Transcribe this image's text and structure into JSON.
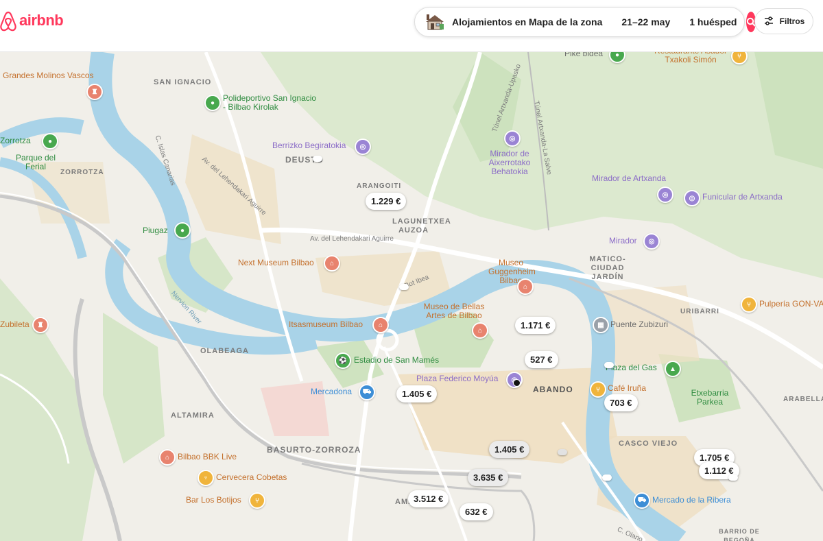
{
  "header": {
    "logo_text": "airbnb",
    "search": {
      "location": "Alojamientos en Mapa de la zona",
      "dates": "21–22 may",
      "guests": "1 huésped"
    },
    "filters_label": "Filtros"
  },
  "map": {
    "districts": [
      "SAN IGNACIO",
      "DEUSTO",
      "ARANGOITI",
      "LAGUNETXEA AUZOA",
      "ZORROTZA",
      "OLABEAGA",
      "ALTAMIRA",
      "BASURTO-ZORROZA",
      "ABANDO",
      "MATICO-CIUDAD JARDÍN",
      "URIBARRI",
      "ARABELLA",
      "CASCO VIEJO",
      "BARRIO DE BEGOÑA"
    ],
    "pois": {
      "grandes_molinos": "Grandes Molinos Vascos",
      "polideportivo": "Polideportivo San Ignacio - Bilbao Kirolak",
      "zorrotza": "Zorrotza",
      "parque_ferial": "Parque del Ferial",
      "berrizko": "Berrizko Begiratokia",
      "mirador_aixerrotako": "Mirador de Aixerrotako Behatokia",
      "mirador_artxanda": "Mirador de Artxanda",
      "funicular": "Funicular de Artxanda",
      "piugaz": "Piugaz",
      "mirador": "Mirador",
      "next_museum": "Next Museum Bilbao",
      "guggenheim": "Museo Guggenheim Bilbao",
      "bellas_artes": "Museo de Bellas Artes de Bilbao",
      "itsasmuseum": "Itsasmuseum Bilbao",
      "puente_zubizuri": "Puente Zubizuri",
      "pulperia": "Pulpería GON-VA",
      "zubileta": "Zubileta",
      "san_mames": "Estadio de San Mamés",
      "plaza_moyua": "Plaza Federico Moyúa",
      "plaza_gas": "Plaza del Gas",
      "mercadona": "Mercadona",
      "cafe_iruna": "Café Iruña",
      "etxebarria": "Etxebarria Parkea",
      "bbk_live": "Bilbao BBK Live",
      "cervecera": "Cervecera Cobetas",
      "bar_botijos": "Bar Los Botijos",
      "mercado_ribera": "Mercado de la Ribera",
      "pike_bidea": "Pike bidea",
      "txakoli": "Restaurante Asador Txakoli Simón",
      "ama": "AMA"
    },
    "streets": {
      "islas_canarias": "C. Islas Canarias",
      "av_lehendakari": "Av. del Lehendakari Aguirre",
      "av_lehendakari_2": "Av. del Lehendakari Aguirre",
      "tunel_artxanda_upasko": "Túnel Artxanda-Upasko",
      "tunel_artxanda_salve": "Túnel Artxanda-La Salve",
      "nervion": "Nervion River",
      "botica": "Bot Ibea",
      "olano": "C. Olano"
    },
    "prices": [
      "1.229 €",
      "1.171 €",
      "527 €",
      "1.405 €",
      "703 €",
      "1.405 €",
      "3.635 €",
      "3.512 €",
      "632 €",
      "1.705 €",
      "1.112 €"
    ]
  }
}
